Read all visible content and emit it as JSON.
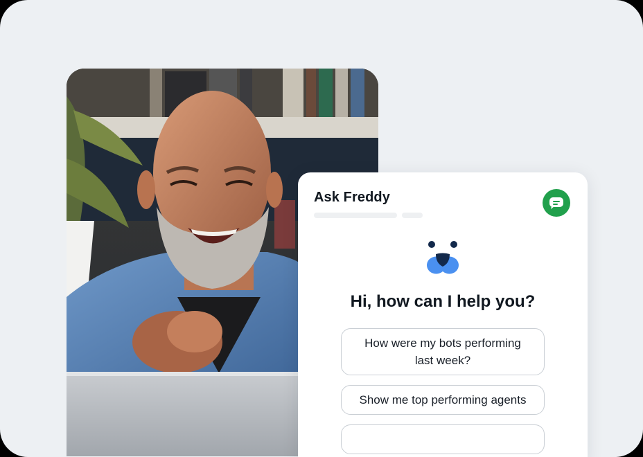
{
  "chat": {
    "title": "Ask Freddy",
    "chat_button_icon": "chat-bubble-icon",
    "logo_icon": "freddy-bear-logo-icon",
    "greeting": "Hi, how can I help you?",
    "suggestions": [
      "How were my bots performing last week?",
      "Show me top performing agents",
      ""
    ]
  },
  "photo": {
    "subject": "smiling-man-at-laptop"
  },
  "colors": {
    "background": "#edf0f3",
    "accent_green": "#21a04c",
    "logo_blue": "#4a90f0",
    "logo_navy": "#13294b"
  }
}
